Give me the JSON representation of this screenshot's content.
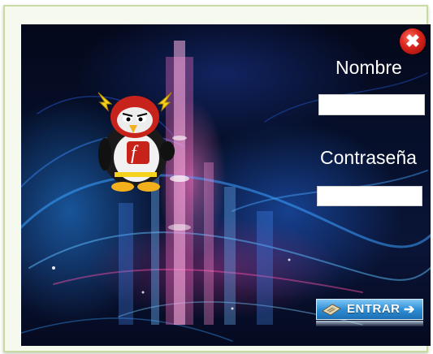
{
  "login": {
    "username_label": "Nombre",
    "username_value": "",
    "password_label": "Contraseña",
    "password_value": "",
    "submit_label": "ENTRAR",
    "submit_arrow": "➔",
    "close_glyph": "✖"
  },
  "icons": {
    "close": "close-icon",
    "mascot": "flash-penguin-mascot",
    "submit": "keyboard-icon"
  },
  "colors": {
    "background": "#050a20",
    "label_text": "#ffffff",
    "close_button": "#d8241c",
    "submit_button": "#2f8fd4",
    "frame_border": "#c9dba4"
  }
}
